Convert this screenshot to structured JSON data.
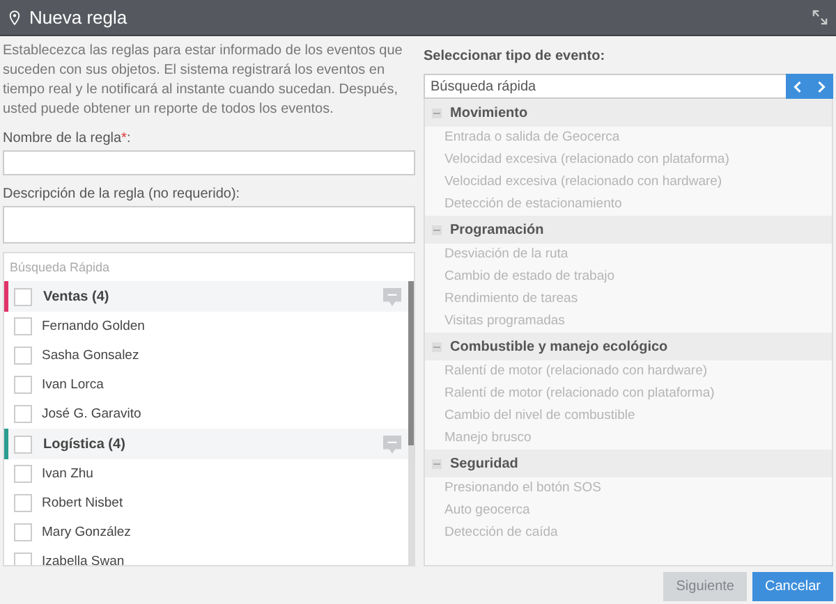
{
  "window": {
    "title": "Nueva regla"
  },
  "intro": "Establecezca las reglas para estar informado de los eventos que suceden con sus objetos. El sistema registrará los eventos en tiempo real y le notificará al instante cuando sucedan. Después, usted puede obtener un reporte de todos los eventos.",
  "fields": [
    {
      "label": "Nombre de la regla",
      "mark": "*",
      "suffix": ":"
    },
    {
      "label": "Descripción de la regla (no requerido):"
    }
  ],
  "objects": {
    "placeholder": "Búsqueda Rápida",
    "groups": [
      {
        "name": "Ventas (4)",
        "color": "#e0336a",
        "checked": false,
        "items": [
          {
            "name": "Fernando Golden",
            "checked": false
          },
          {
            "name": "Sasha Gonsalez",
            "checked": false
          },
          {
            "name": "Ivan Lorca",
            "checked": false
          },
          {
            "name": "José G. Garavito",
            "checked": false
          }
        ]
      },
      {
        "name": "Logística (4)",
        "color": "#2a9d8f",
        "checked": false,
        "items": [
          {
            "name": "Ivan Zhu",
            "checked": false
          },
          {
            "name": "Robert Nisbet",
            "checked": false
          },
          {
            "name": "Mary González",
            "checked": false
          },
          {
            "name": "Izabella Swan",
            "checked": false
          }
        ]
      }
    ]
  },
  "events": {
    "label": "Seleccionar tipo de evento:",
    "placeholder": "Búsqueda rápida",
    "categories": [
      {
        "name": "Movimiento",
        "expanded": true,
        "children": [
          {
            "name": "Entrada o salida de Geocerca",
            "disabled": true
          },
          {
            "name": "Velocidad excesiva (relacionado con plataforma)",
            "disabled": true
          },
          {
            "name": "Velocidad excesiva (relacionado con hardware)",
            "disabled": true
          },
          {
            "name": "Detección de estacionamiento",
            "disabled": true
          }
        ]
      },
      {
        "name": "Programación",
        "expanded": true,
        "children": [
          {
            "name": "Desviación de la ruta",
            "disabled": true
          },
          {
            "name": "Cambio de estado de trabajo",
            "disabled": true
          },
          {
            "name": "Rendimiento de tareas",
            "disabled": true
          },
          {
            "name": "Visitas programadas",
            "disabled": true
          }
        ]
      },
      {
        "name": "Combustible y manejo ecológico",
        "expanded": true,
        "children": [
          {
            "name": "Ralentí de motor (relacionado con hardware)",
            "disabled": true
          },
          {
            "name": "Ralentí de motor (relacionado con plataforma)",
            "disabled": true
          },
          {
            "name": "Cambio del nivel de combustible",
            "disabled": true
          },
          {
            "name": "Manejo brusco",
            "disabled": true
          }
        ]
      },
      {
        "name": "Seguridad",
        "expanded": true,
        "children": [
          {
            "name": "Presionando el botón SOS",
            "disabled": true
          },
          {
            "name": "Auto geocerca",
            "disabled": true
          },
          {
            "name": "Detección de caída",
            "disabled": true
          }
        ]
      }
    ]
  },
  "buttons": [
    {
      "label": "Siguiente",
      "disabled": true
    },
    {
      "label": "Cancelar",
      "disabled": false
    }
  ]
}
